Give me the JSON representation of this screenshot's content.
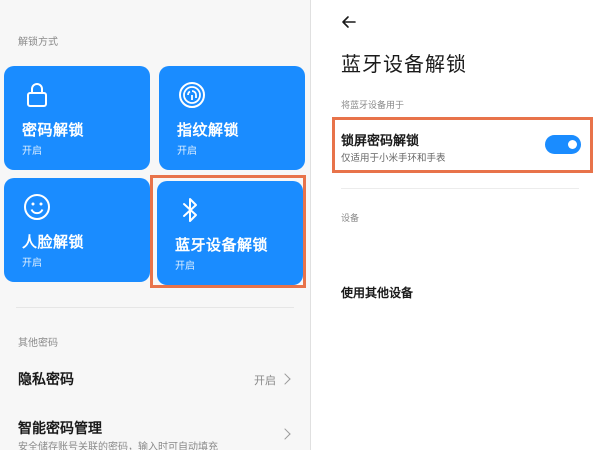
{
  "left_panel": {
    "section_unlock_label": "解锁方式",
    "tiles": [
      {
        "title": "密码解锁",
        "status": "开启",
        "icon": "lock-icon"
      },
      {
        "title": "指纹解锁",
        "status": "开启",
        "icon": "fingerprint-icon"
      },
      {
        "title": "人脸解锁",
        "status": "开启",
        "icon": "face-icon"
      },
      {
        "title": "蓝牙设备解锁",
        "status": "开启",
        "icon": "bluetooth-icon"
      }
    ],
    "section_other_label": "其他密码",
    "privacy_password": {
      "title": "隐私密码",
      "value": "开启"
    },
    "smart_password": {
      "title": "智能密码管理",
      "subtitle": "安全储存账号关联的密码，输入时可自动填充"
    }
  },
  "right_panel": {
    "title": "蓝牙设备解锁",
    "usage_label": "将蓝牙设备用于",
    "lock_screen": {
      "title": "锁屏密码解锁",
      "subtitle": "仅适用于小米手环和手表",
      "enabled": true
    },
    "devices_label": "设备",
    "use_other_device": "使用其他设备"
  },
  "colors": {
    "accent": "#1a8cff",
    "highlight": "#e8734a"
  }
}
